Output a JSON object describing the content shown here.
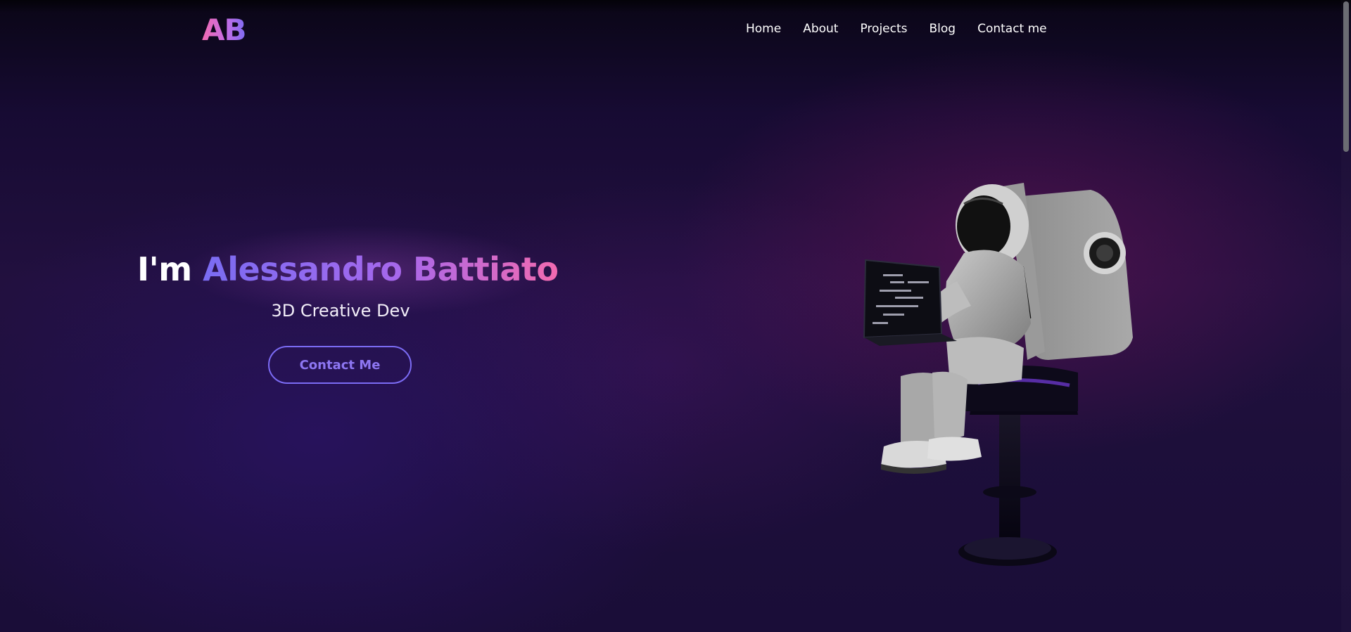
{
  "header": {
    "logo_text": "AB",
    "nav_items": [
      "Home",
      "About",
      "Projects",
      "Blog",
      "Contact me"
    ]
  },
  "hero": {
    "title_prefix": "I'm ",
    "name": "Alessandro Battiato",
    "subtitle": "3D Creative Dev",
    "cta_label": "Contact Me"
  },
  "scene": {
    "laptop_code_label": "code-screen"
  },
  "colors": {
    "background_dark": "#170b33",
    "gradient_purple": "#7a6cf2",
    "gradient_pink": "#f26ab0",
    "button_border": "#7c6cf5"
  }
}
